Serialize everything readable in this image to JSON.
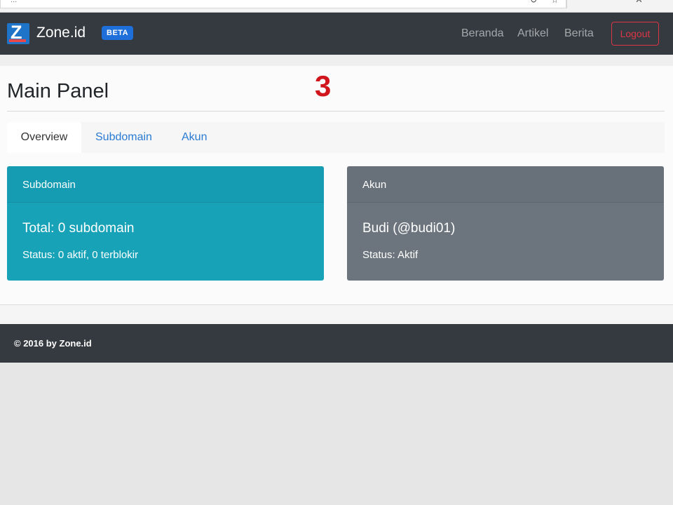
{
  "browser": {
    "url_fragment": "...",
    "reload_glyph": "↻",
    "star_glyph": "☆",
    "close_glyph": "✕"
  },
  "navbar": {
    "logo_letter": "Z",
    "brand": "Zone.id",
    "badge": "BETA",
    "links": [
      "Beranda",
      "Artikel",
      "Berita"
    ],
    "logout": "Logout"
  },
  "page": {
    "title": "Main Panel",
    "step_number": "3"
  },
  "tabs": [
    "Overview",
    "Subdomain",
    "Akun"
  ],
  "cards": [
    {
      "header": "Subdomain",
      "title": "Total: 0 subdomain",
      "text": "Status: 0 aktif, 0 terblokir",
      "color": "#17a2b8"
    },
    {
      "header": "Akun",
      "title": "Budi (@budi01)",
      "text": "Status: Aktif",
      "color": "#6c757d"
    }
  ],
  "footer": {
    "text": "© 2016 by Zone.id"
  },
  "colors": {
    "navbar": "#343a40",
    "danger": "#dc3545",
    "link": "#2a7bd4",
    "step_red": "#d0161c"
  }
}
